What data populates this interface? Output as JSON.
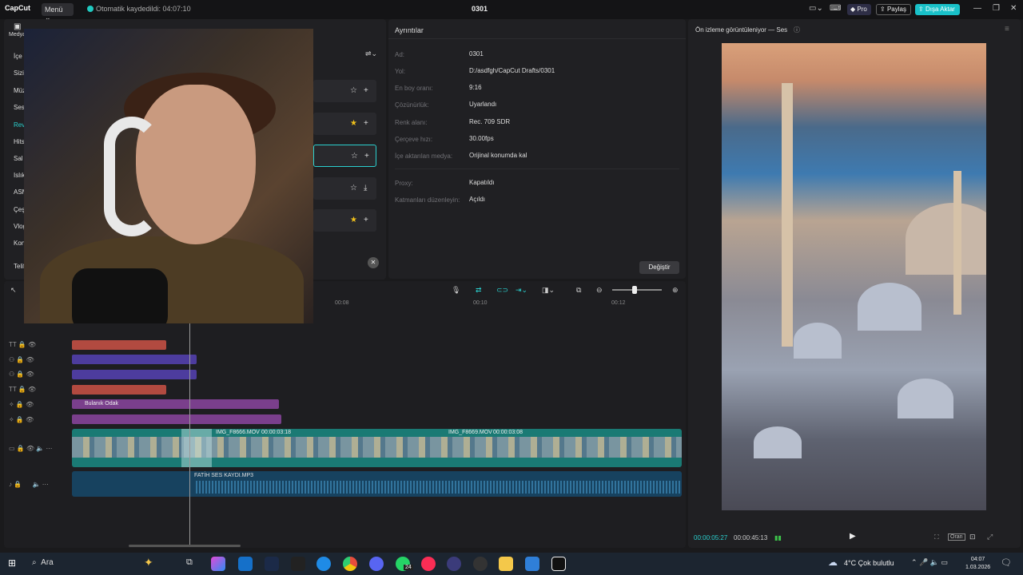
{
  "app": {
    "logo": "CapCut",
    "menu_label": "Menü",
    "autosave": "Otomatik kaydedildi: 04:07:10",
    "project_title": "0301",
    "pro_label": "Pro",
    "share_label": "Paylaş",
    "export_label": "Dışa Aktar",
    "accent": "#19c1c9"
  },
  "left_panel": {
    "media_label": "Medya",
    "sidebar_items": [
      "İçe a",
      "Sizin",
      "Müz",
      "Ses",
      "Rev",
      "Hits",
      "Sal",
      "Islık",
      "ASM",
      "Çeş",
      "Vlog",
      "Kon",
      "Telif"
    ]
  },
  "details": {
    "title": "Ayrıntılar",
    "rows": [
      {
        "label": "Ad:",
        "value": "0301"
      },
      {
        "label": "Yol:",
        "value": "D:/asdfgh/CapCut Drafts/0301"
      },
      {
        "label": "En boy oranı:",
        "value": "9:16"
      },
      {
        "label": "Çözünürlük:",
        "value": "Uyarlandı"
      },
      {
        "label": "Renk alanı:",
        "value": "Rec. 709 SDR"
      },
      {
        "label": "Çerçeve hızı:",
        "value": "30.00fps"
      },
      {
        "label": "İçe aktarılan medya:",
        "value": "Orijinal konumda kal"
      },
      {
        "label": "Proxy:",
        "value": "Kapatıldı"
      },
      {
        "label": "Katmanları düzenleyin:",
        "value": "Açıldı"
      }
    ],
    "change_button": "Değiştir"
  },
  "preview": {
    "title": "Ön izleme görüntüleniyor — Ses",
    "time_current": "00:00:05:27",
    "time_total": "00:00:45:13",
    "ratio_label": "Oran"
  },
  "timeline": {
    "ruler": [
      "00:08",
      "00:10",
      "00:12"
    ],
    "effect_clip_label": "Bulanık Odak",
    "video_clip_1": "IMG_F8666.MOV",
    "video_clip_1_dur": "00:00:03:18",
    "video_clip_2": "IMG_F8669.MOV",
    "video_clip_2_dur": "00:00:03:08",
    "audio_clip_label": "FATİH SES KAYDI.MP3"
  },
  "taskbar": {
    "search_label": "Ara",
    "weather": "4°C  Çok bulutlu",
    "time": "04:07",
    "date": "1.03.2026",
    "badge": "24"
  }
}
